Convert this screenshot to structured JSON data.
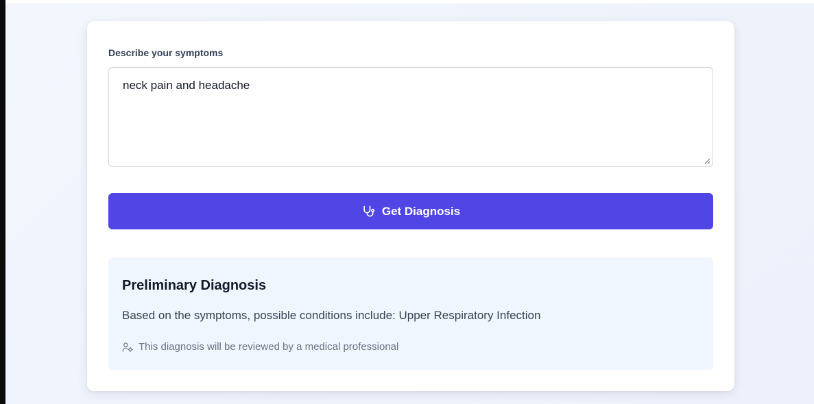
{
  "form": {
    "label": "Describe your symptoms",
    "symptoms_value": "neck pain and headache"
  },
  "actions": {
    "diagnose_label": "Get Diagnosis"
  },
  "result": {
    "title": "Preliminary Diagnosis",
    "text": "Based on the symptoms, possible conditions include: Upper Respiratory Infection",
    "note": "This diagnosis will be reviewed by a medical professional"
  },
  "icons": {
    "diagnose_button": "stethoscope-icon",
    "review_note": "user-cog-icon"
  },
  "colors": {
    "accent": "#4f46e5",
    "result_bg": "#eff6ff",
    "page_bg": "#f1f4fc"
  }
}
